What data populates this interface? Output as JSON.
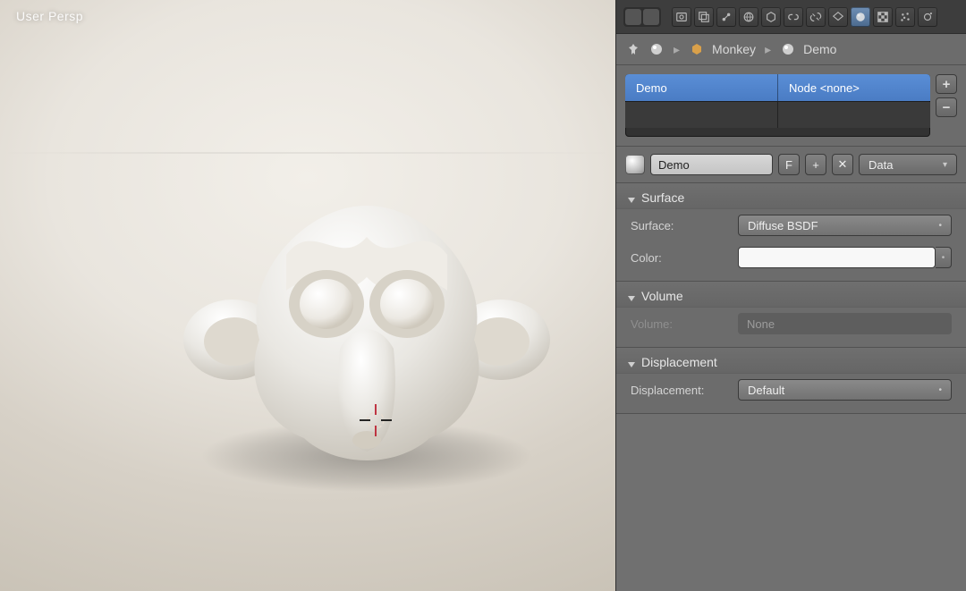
{
  "viewport": {
    "label": "User Persp"
  },
  "breadcrumb": {
    "object": "Monkey",
    "material": "Demo"
  },
  "material_list": {
    "slots": [
      {
        "name": "Demo",
        "node": "Node <none>",
        "selected": true
      }
    ]
  },
  "material_name_field": "Demo",
  "fake_user_label": "F",
  "data_link_mode": "Data",
  "sections": {
    "surface": {
      "title": "Surface",
      "surface_label": "Surface:",
      "surface_value": "Diffuse BSDF",
      "color_label": "Color:"
    },
    "volume": {
      "title": "Volume",
      "volume_label": "Volume:",
      "volume_value": "None"
    },
    "displacement": {
      "title": "Displacement",
      "disp_label": "Displacement:",
      "disp_value": "Default"
    }
  }
}
